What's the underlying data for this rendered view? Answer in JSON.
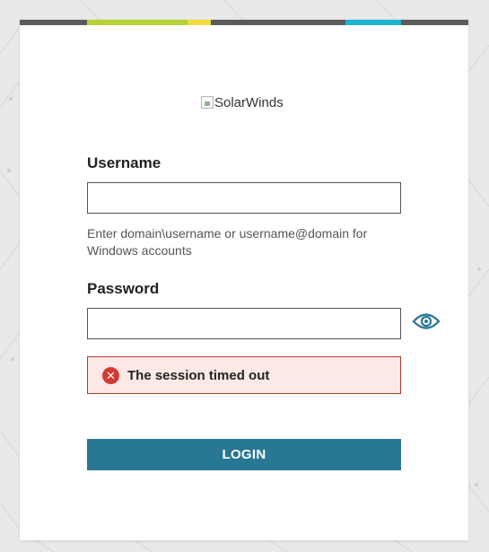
{
  "brand": {
    "logo_alt": "SolarWinds",
    "stripe_colors": [
      "#5b5b5b",
      "#b5d334",
      "#f2da3a",
      "#5b5b5b",
      "#1bb5d1",
      "#5b5b5b"
    ]
  },
  "form": {
    "username_label": "Username",
    "username_value": "",
    "username_hint": "Enter domain\\username or username@domain for Windows accounts",
    "password_label": "Password",
    "password_value": "",
    "show_password_icon": "eye-icon"
  },
  "error": {
    "icon": "error-x-icon",
    "message": "The session timed out",
    "color": "#d23a34"
  },
  "login_button_label": "LOGIN",
  "colors": {
    "accent": "#287793",
    "background": "#e9e9e9",
    "error_bg": "#fce9e6",
    "error_border": "#b13b2f"
  }
}
